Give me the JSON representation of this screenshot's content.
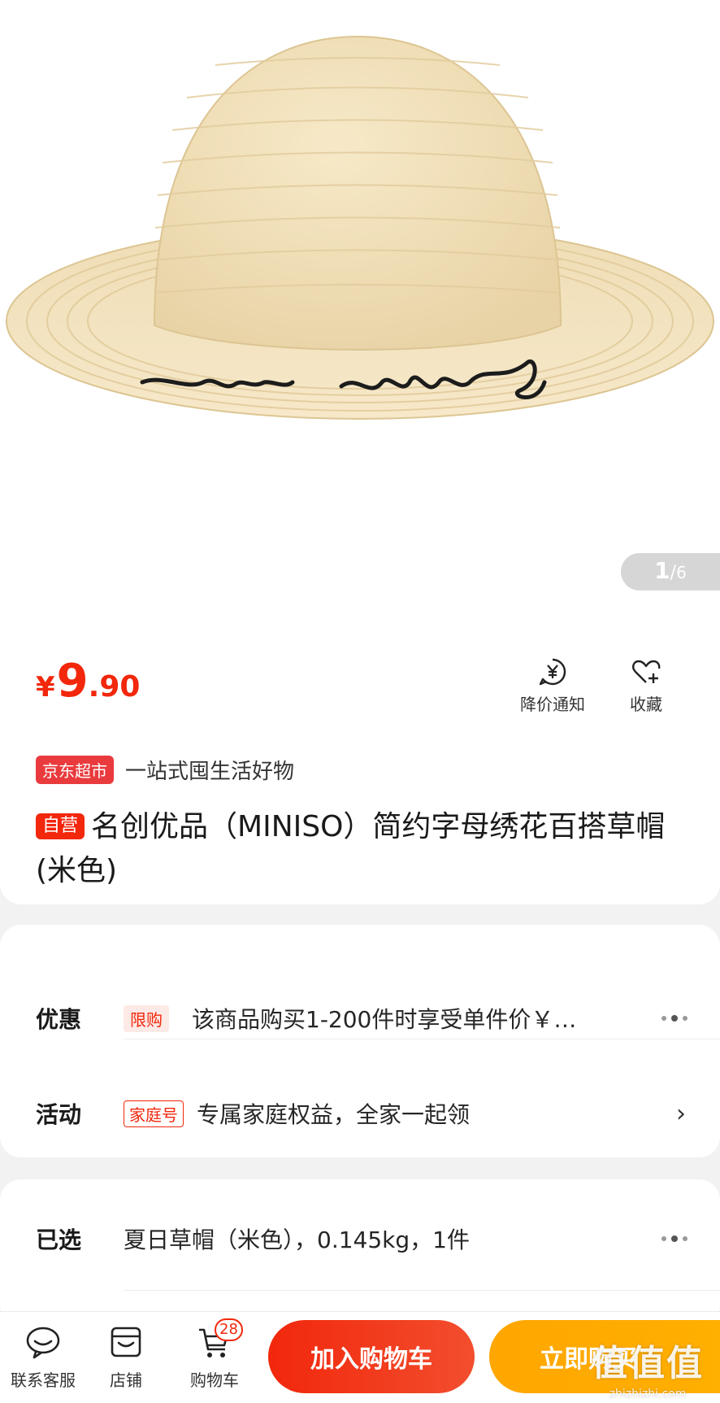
{
  "gallery": {
    "current": "1",
    "separator": "/",
    "total": "6",
    "embroidery_text": "do busy"
  },
  "price": {
    "currency": "¥",
    "integer": "9",
    "decimal": ".90"
  },
  "actions": {
    "price_alert": "降价通知",
    "favorite": "收藏"
  },
  "store": {
    "tag": "京东超市",
    "slogan": "一站式囤生活好物"
  },
  "product": {
    "self_tag": "自营",
    "title": "名创优品（MINISO）简约字母绣花百搭草帽(米色)"
  },
  "promotion": {
    "label": "优惠",
    "badge": "限购",
    "text": "该商品购买1-200件时享受单件价￥…"
  },
  "activity": {
    "label": "活动",
    "badge": "家庭号",
    "text": "专属家庭权益，全家一起领",
    "chevron": "›"
  },
  "selection": {
    "label": "已选",
    "text": "夏日草帽（米色），0.145kg，1件"
  },
  "bottom_nav": {
    "service": "联系客服",
    "shop": "店铺",
    "cart": "购物车",
    "cart_count": "28",
    "add_to_cart": "加入购物车",
    "buy_now": "立即购买"
  },
  "watermark": {
    "big": "值值值",
    "small": "zhizhizhi.com"
  },
  "colors": {
    "accent": "#f2270c",
    "buy": "#ffa600"
  }
}
